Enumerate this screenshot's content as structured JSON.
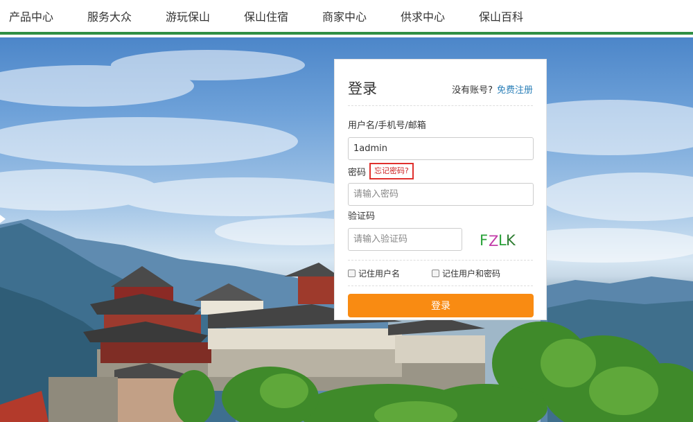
{
  "nav": {
    "items": [
      "产品中心",
      "服务大众",
      "游玩保山",
      "保山住宿",
      "商家中心",
      "供求中心",
      "保山百科"
    ]
  },
  "login": {
    "title": "登录",
    "no_account": "没有账号?",
    "register_link": "免费注册",
    "username_label": "用户名/手机号/邮箱",
    "username_value": "1admin",
    "password_label": "密码",
    "forgot_password": "忘记密码?",
    "password_placeholder": "请输入密码",
    "captcha_label": "验证码",
    "captcha_placeholder": "请输入验证码",
    "captcha_text": "FZLK",
    "remember_username": "记住用户名",
    "remember_both": "记住用户和密码",
    "submit_label": "登录"
  },
  "colors": {
    "nav_accent": "#2f8f45",
    "button": "#f98b12",
    "link": "#2a7fb8",
    "forgot_border": "#e0302d"
  }
}
